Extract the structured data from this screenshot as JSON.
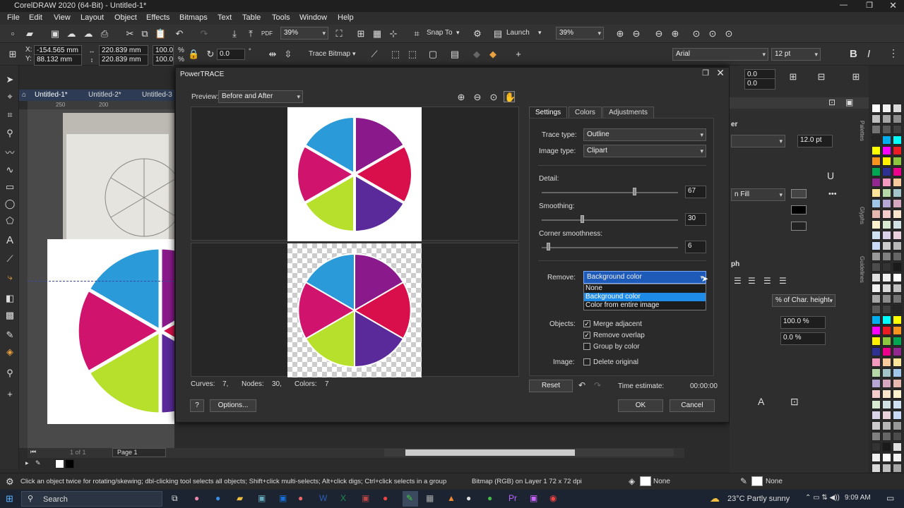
{
  "window": {
    "title": "CorelDRAW 2020 (64-Bit) - Untitled-1*"
  },
  "menu": [
    "File",
    "Edit",
    "View",
    "Layout",
    "Object",
    "Effects",
    "Bitmaps",
    "Text",
    "Table",
    "Tools",
    "Window",
    "Help"
  ],
  "toolbar1": {
    "zoom_a": "39%",
    "snap_label": "Snap To",
    "launch_label": "Launch",
    "zoom_b": "39%"
  },
  "toolbar2": {
    "x_label": "X:",
    "x_value": "-154.565 mm",
    "y_label": "Y:",
    "y_value": "88.132 mm",
    "w_value": "220.839 mm",
    "h_value": "220.839 mm",
    "scale_w": "100.0",
    "scale_h": "100.0",
    "pct": "%",
    "angle": "0.0",
    "trace_label": "Trace Bitmap",
    "font": "Arial",
    "font_size": "12 pt"
  },
  "doc_tabs": [
    "Untitled-1*",
    "Untitled-2*",
    "Untitled-3"
  ],
  "ruler_marks": [
    "250",
    "200"
  ],
  "page_nav": {
    "of": "1 of 1",
    "page_tab": "Page 1"
  },
  "dialog": {
    "title": "PowerTRACE",
    "preview_label": "Preview:",
    "preview_value": "Before and After",
    "tabs": [
      "Settings",
      "Colors",
      "Adjustments"
    ],
    "trace_type_label": "Trace type:",
    "trace_type_value": "Outline",
    "image_type_label": "Image type:",
    "image_type_value": "Clipart",
    "detail_label": "Detail:",
    "detail_value": "67",
    "smoothing_label": "Smoothing:",
    "smoothing_value": "30",
    "corner_label": "Corner smoothness:",
    "corner_value": "6",
    "remove_label": "Remove:",
    "remove_value": "Background color",
    "remove_options": [
      "None",
      "Background color",
      "Color from entire image"
    ],
    "objects_label": "Objects:",
    "merge_adjacent": "Merge adjacent",
    "remove_overlap": "Remove overlap",
    "group_by_color": "Group by color",
    "image_label": "Image:",
    "delete_original": "Delete original",
    "curves_label": "Curves:",
    "curves_value": "7,",
    "nodes_label": "Nodes:",
    "nodes_value": "30,",
    "colors_label": "Colors:",
    "colors_value": "7",
    "reset": "Reset",
    "time_label": "Time estimate:",
    "time_value": "00:00:00",
    "help": "?",
    "options": "Options...",
    "ok": "OK",
    "cancel": "Cancel",
    "wheel_colors": [
      "#8a1a8c",
      "#d80f4a",
      "#5a2a9a",
      "#b6e02b",
      "#d0146e",
      "#2a9ad8"
    ]
  },
  "right_dock": {
    "size1": "0.0",
    "size2": "0.0",
    "font_size": "12.0 pt",
    "h_label": "er",
    "fill_label": "n Fill",
    "para_label": "ph",
    "char_height": "% of Char. height",
    "pct100": "100.0 %",
    "pct0": "0.0 %",
    "side_tabs": [
      "Palettes",
      "Glyphs",
      "Guidelines"
    ]
  },
  "status": {
    "hint": "Click an object twice for rotating/skewing; dbl-clicking tool selects all objects; Shift+click multi-selects; Alt+click digs; Ctrl+click selects in a group",
    "bitmap": "Bitmap (RGB) on Layer 1 72 x 72 dpi",
    "fill": "None",
    "outline": "None"
  },
  "taskbar": {
    "search": "Search",
    "weather": "23°C  Partly sunny",
    "time": "9:09 AM"
  }
}
